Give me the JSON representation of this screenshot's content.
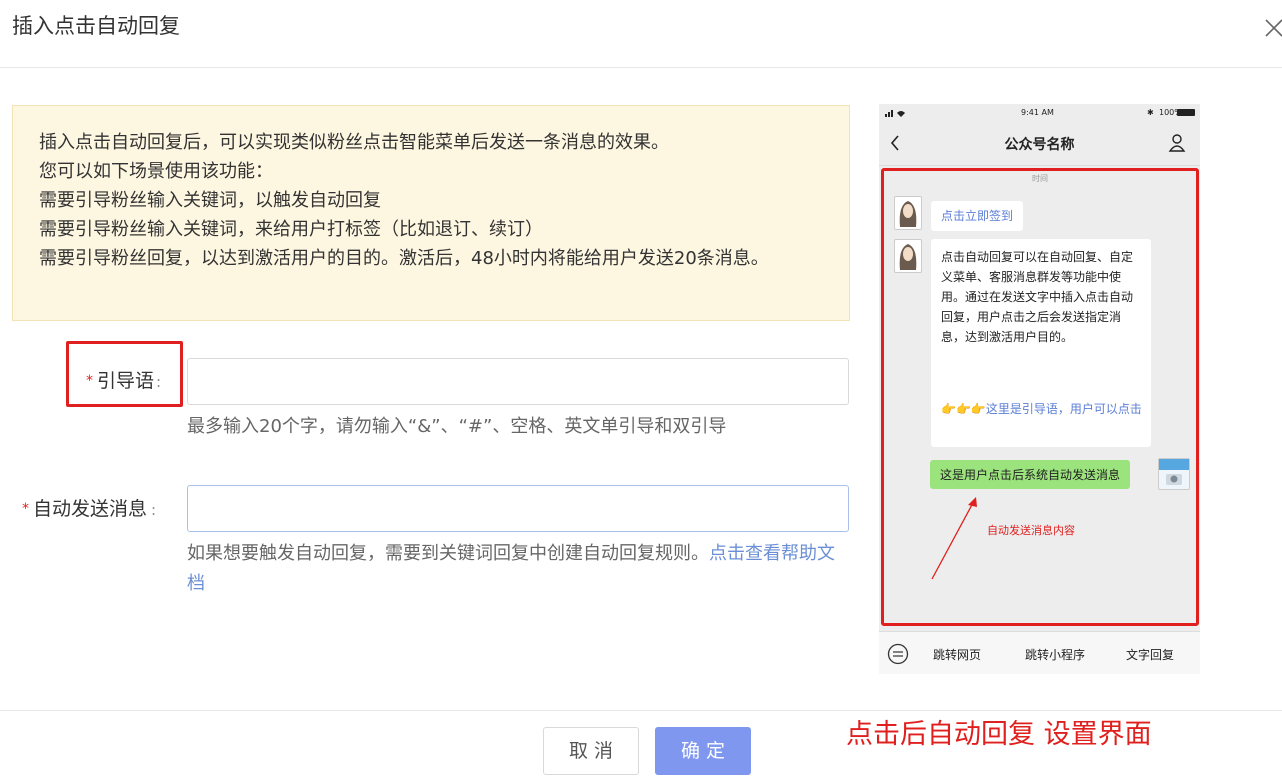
{
  "dialog": {
    "title": "插入点击自动回复",
    "close_icon": "close-icon"
  },
  "notice": {
    "lines": [
      "插入点击自动回复后，可以实现类似粉丝点击智能菜单后发送一条消息的效果。",
      "您可以如下场景使用该功能：",
      "需要引导粉丝输入关键词，以触发自动回复",
      "需要引导粉丝输入关键词，来给用户打标签（比如退订、续订）",
      "需要引导粉丝回复，以达到激活用户的目的。激活后，48小时内将能给用户发送20条消息。"
    ]
  },
  "form": {
    "guide": {
      "required_mark": "*",
      "label": "引导语",
      "colon": ":",
      "value": "",
      "hint": "最多输入20个字，请勿输入“&”、“#”、空格、英文单引导和双引导"
    },
    "auto_message": {
      "required_mark": "*",
      "label": "自动发送消息",
      "colon": ":",
      "value": "",
      "hint": "如果想要触发自动回复，需要到关键词回复中创建自动回复规则。",
      "hint_link": "点击查看帮助文档"
    }
  },
  "phone": {
    "status_time": "9:41 AM",
    "status_battery": "100%",
    "nav_title": "公众号名称",
    "chat_divider": "时间",
    "bubble1": "点击立即签到",
    "bubble2_text": "点击自动回复可以在自动回复、自定义菜单、客服消息群发等功能中使用。通过在发送文字中插入点击自动回复，用户点击之后会发送指定消息，达到激活用户目的。",
    "bubble2_hint_emoji": "👉👉👉",
    "bubble2_hint": "这里是引导语，用户可以点击",
    "bubble3": "这是用户点击后系统自动发送消息",
    "annotation": "自动发送消息内容",
    "menu": [
      "跳转网页",
      "跳转小程序",
      "文字回复"
    ]
  },
  "footer": {
    "cancel": "取 消",
    "ok": "确 定"
  },
  "caption": "点击后自动回复 设置界面",
  "colors": {
    "accent_red": "#e0201e",
    "primary_button": "#7f97ee",
    "link_blue": "#6b8fd6",
    "notice_bg": "#fdf6e1",
    "wechat_green": "#9be37c"
  }
}
